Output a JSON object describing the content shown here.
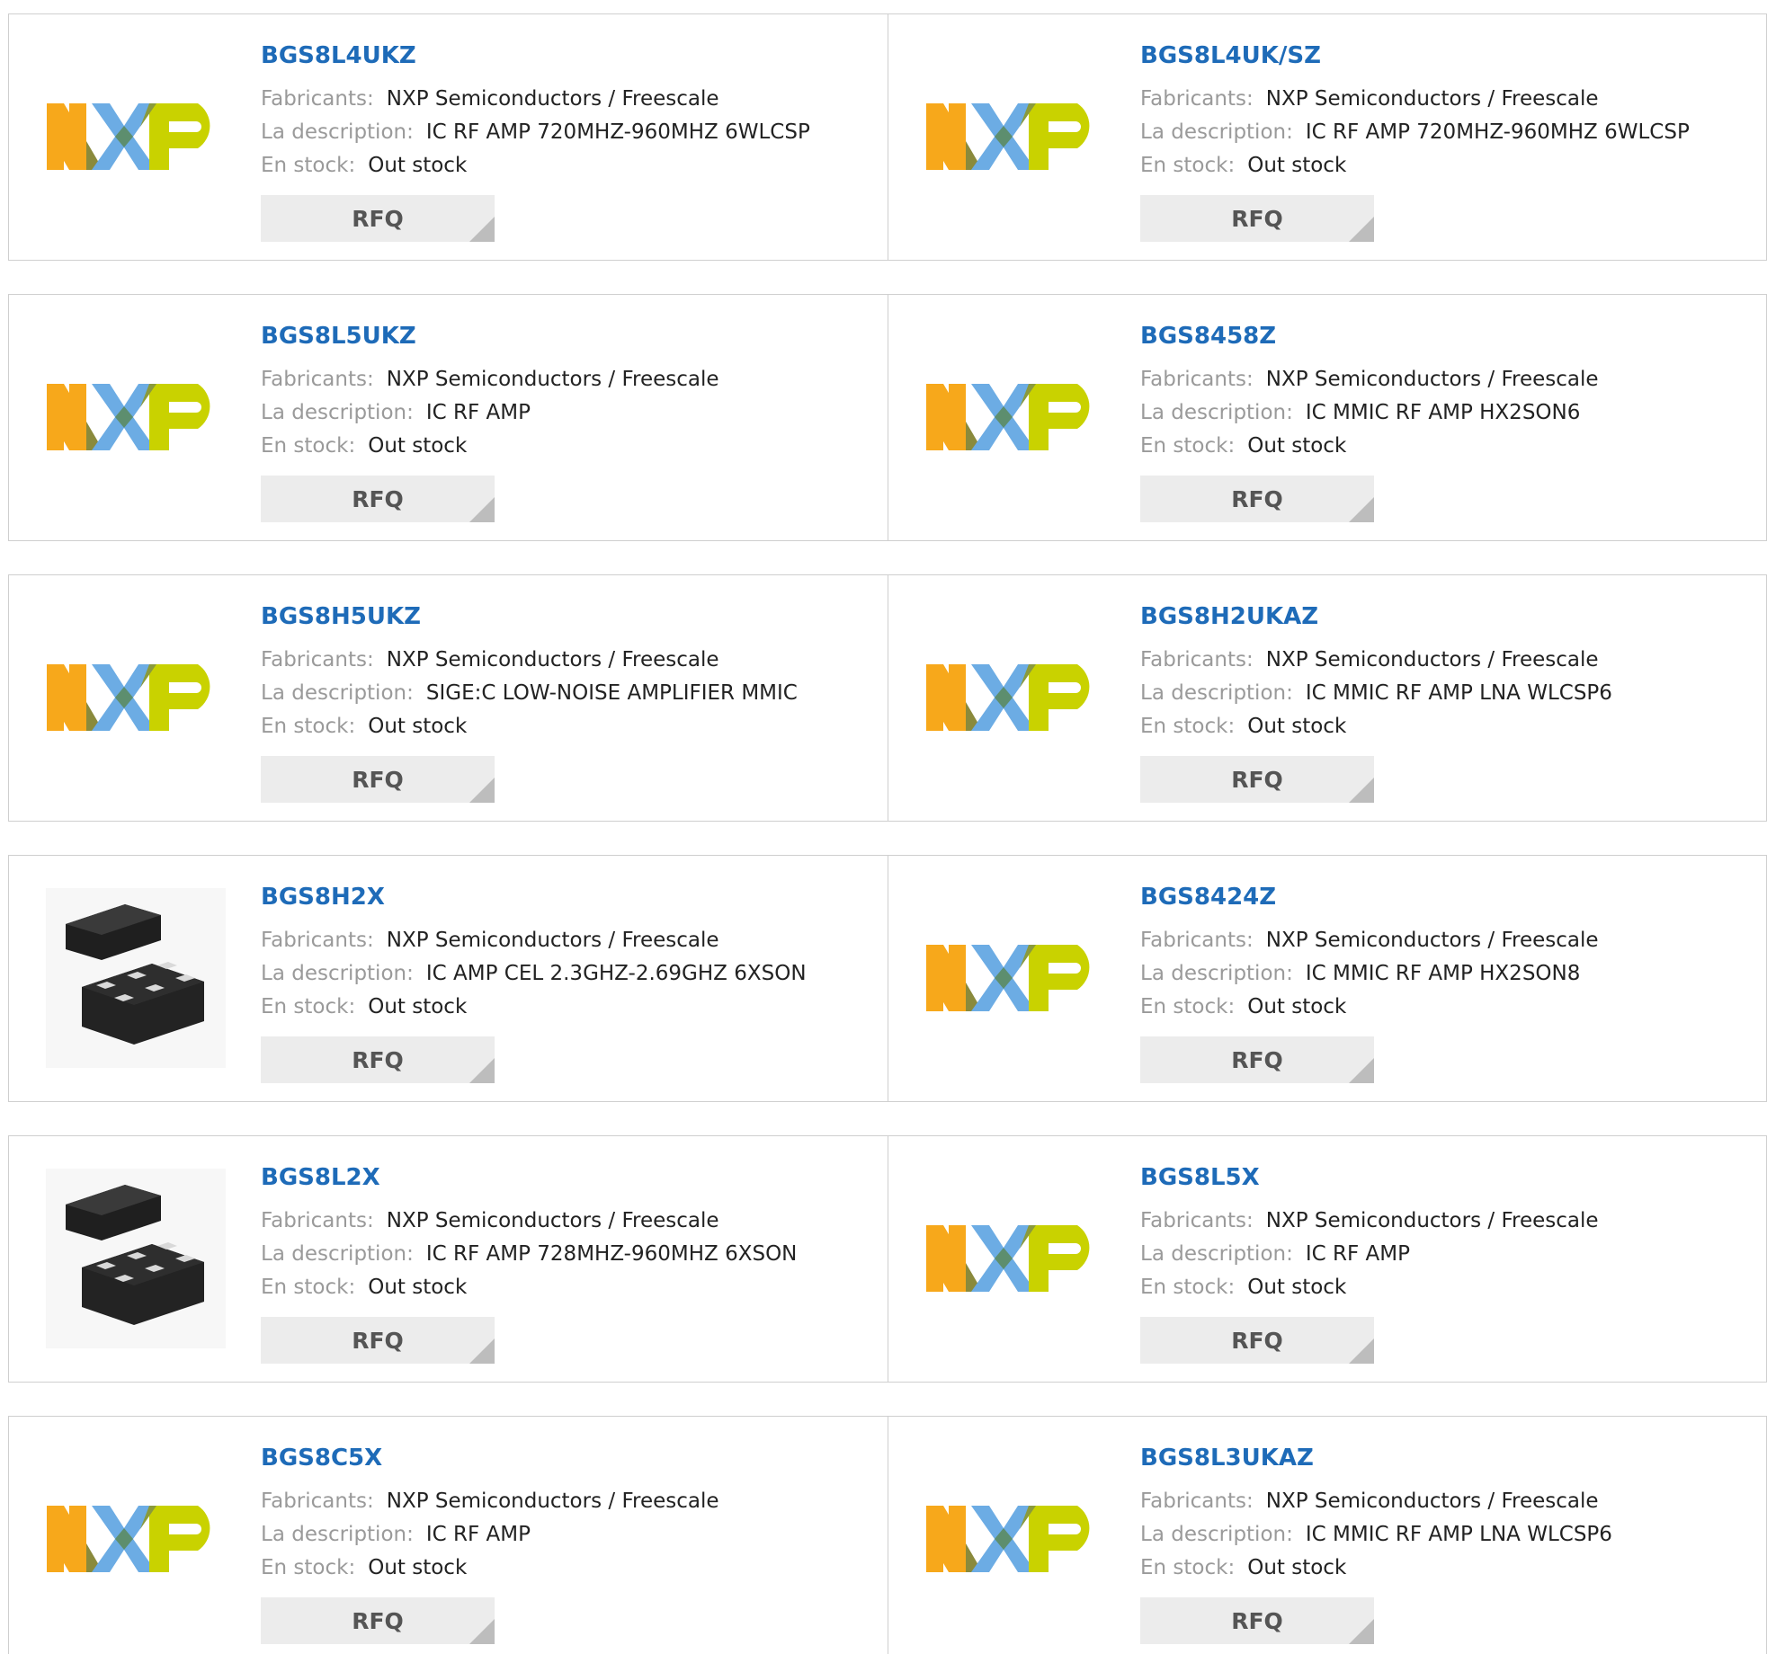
{
  "labels": {
    "manufacturer": "Fabricants:",
    "description": "La description:",
    "stock": "En stock:",
    "rfq": "RFQ"
  },
  "colors": {
    "part_link": "#1e6bb8",
    "nxp_orange": "#f7a81b",
    "nxp_blue": "#6cace4",
    "nxp_green": "#c9d200"
  },
  "products": [
    {
      "part": "BGS8L4UKZ",
      "manufacturer": "NXP Semiconductors / Freescale",
      "description": "IC RF AMP 720MHZ-960MHZ 6WLCSP",
      "stock": "Out stock",
      "image": "nxp-logo"
    },
    {
      "part": "BGS8L4UK/SZ",
      "manufacturer": "NXP Semiconductors / Freescale",
      "description": "IC RF AMP 720MHZ-960MHZ 6WLCSP",
      "stock": "Out stock",
      "image": "nxp-logo"
    },
    {
      "part": "BGS8L5UKZ",
      "manufacturer": "NXP Semiconductors / Freescale",
      "description": "IC RF AMP",
      "stock": "Out stock",
      "image": "nxp-logo"
    },
    {
      "part": "BGS8458Z",
      "manufacturer": "NXP Semiconductors / Freescale",
      "description": "IC MMIC RF AMP HX2SON6",
      "stock": "Out stock",
      "image": "nxp-logo"
    },
    {
      "part": "BGS8H5UKZ",
      "manufacturer": "NXP Semiconductors / Freescale",
      "description": "SIGE:C LOW-NOISE AMPLIFIER MMIC",
      "stock": "Out stock",
      "image": "nxp-logo"
    },
    {
      "part": "BGS8H2UKAZ",
      "manufacturer": "NXP Semiconductors / Freescale",
      "description": "IC MMIC RF AMP LNA WLCSP6",
      "stock": "Out stock",
      "image": "nxp-logo"
    },
    {
      "part": "BGS8H2X",
      "manufacturer": "NXP Semiconductors / Freescale",
      "description": "IC AMP CEL 2.3GHZ-2.69GHZ 6XSON",
      "stock": "Out stock",
      "image": "chip-package"
    },
    {
      "part": "BGS8424Z",
      "manufacturer": "NXP Semiconductors / Freescale",
      "description": "IC MMIC RF AMP HX2SON8",
      "stock": "Out stock",
      "image": "nxp-logo"
    },
    {
      "part": "BGS8L2X",
      "manufacturer": "NXP Semiconductors / Freescale",
      "description": "IC RF AMP 728MHZ-960MHZ 6XSON",
      "stock": "Out stock",
      "image": "chip-package"
    },
    {
      "part": "BGS8L5X",
      "manufacturer": "NXP Semiconductors / Freescale",
      "description": "IC RF AMP",
      "stock": "Out stock",
      "image": "nxp-logo"
    },
    {
      "part": "BGS8C5X",
      "manufacturer": "NXP Semiconductors / Freescale",
      "description": "IC RF AMP",
      "stock": "Out stock",
      "image": "nxp-logo"
    },
    {
      "part": "BGS8L3UKAZ",
      "manufacturer": "NXP Semiconductors / Freescale",
      "description": "IC MMIC RF AMP LNA WLCSP6",
      "stock": "Out stock",
      "image": "nxp-logo"
    }
  ]
}
